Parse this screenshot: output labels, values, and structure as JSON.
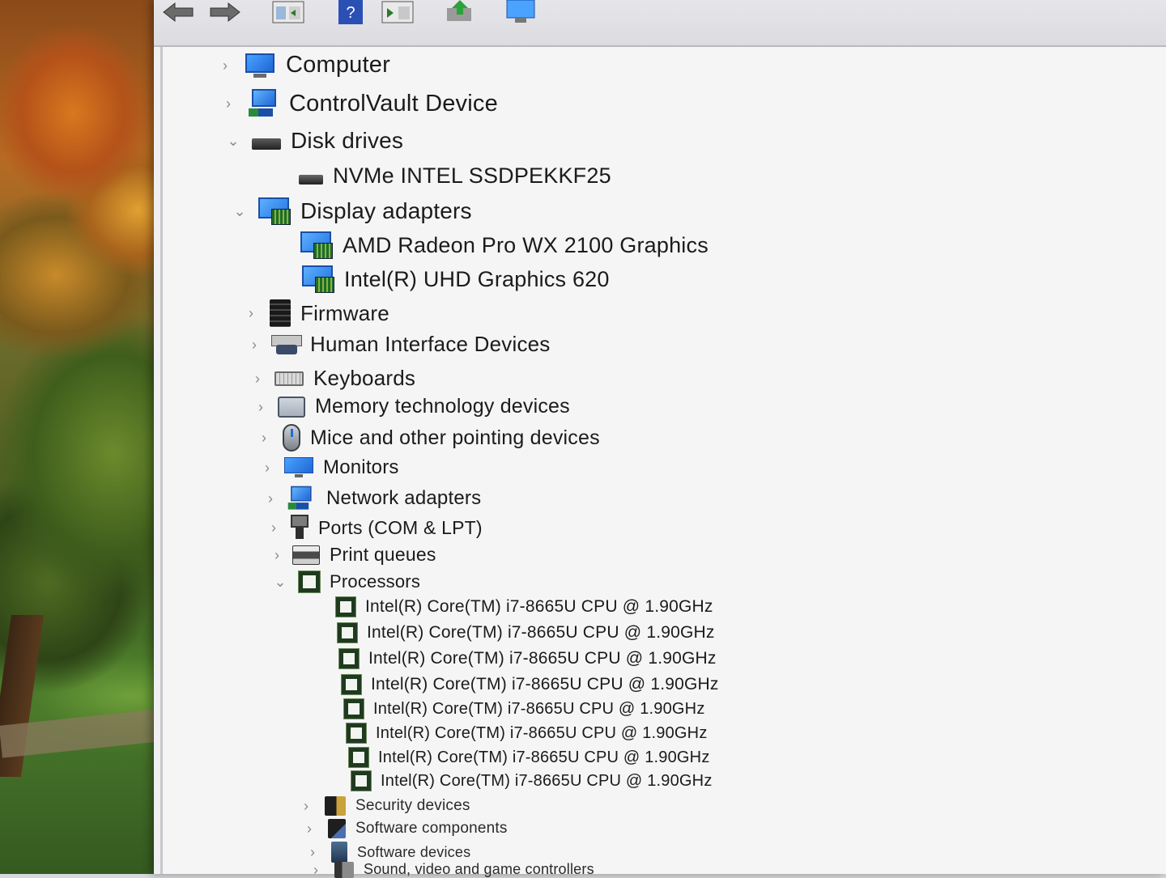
{
  "toolbar": {
    "buttons": [
      "back-icon",
      "forward-icon",
      "properties-icon",
      "help-icon",
      "show-hide-console-icon",
      "update-driver-icon",
      "scan-hardware-icon"
    ]
  },
  "tree": {
    "computer": "Computer",
    "controlvault": "ControlVault Device",
    "disk_drives": "Disk drives",
    "disk_0": "NVMe INTEL SSDPEKKF25",
    "display_adapters": "Display adapters",
    "display_0": "AMD Radeon Pro WX 2100 Graphics",
    "display_1": "Intel(R) UHD Graphics 620",
    "firmware": "Firmware",
    "hid": "Human Interface Devices",
    "keyboards": "Keyboards",
    "memory_tech": "Memory technology devices",
    "mice": "Mice and other pointing devices",
    "monitors": "Monitors",
    "network": "Network adapters",
    "ports": "Ports (COM & LPT)",
    "print_queues": "Print queues",
    "processors": "Processors",
    "cpu": [
      "Intel(R) Core(TM) i7-8665U CPU @ 1.90GHz",
      "Intel(R) Core(TM) i7-8665U CPU @ 1.90GHz",
      "Intel(R) Core(TM) i7-8665U CPU @ 1.90GHz",
      "Intel(R) Core(TM) i7-8665U CPU @ 1.90GHz",
      "Intel(R) Core(TM) i7-8665U CPU @ 1.90GHz",
      "Intel(R) Core(TM) i7-8665U CPU @ 1.90GHz",
      "Intel(R) Core(TM) i7-8665U CPU @ 1.90GHz",
      "Intel(R) Core(TM) i7-8665U CPU @ 1.90GHz"
    ],
    "security": "Security devices",
    "software_components": "Software components",
    "software_devices": "Software devices",
    "sound": "Sound, video and game controllers"
  },
  "chevrons": {
    "collapsed": "›",
    "expanded": "⌄"
  }
}
